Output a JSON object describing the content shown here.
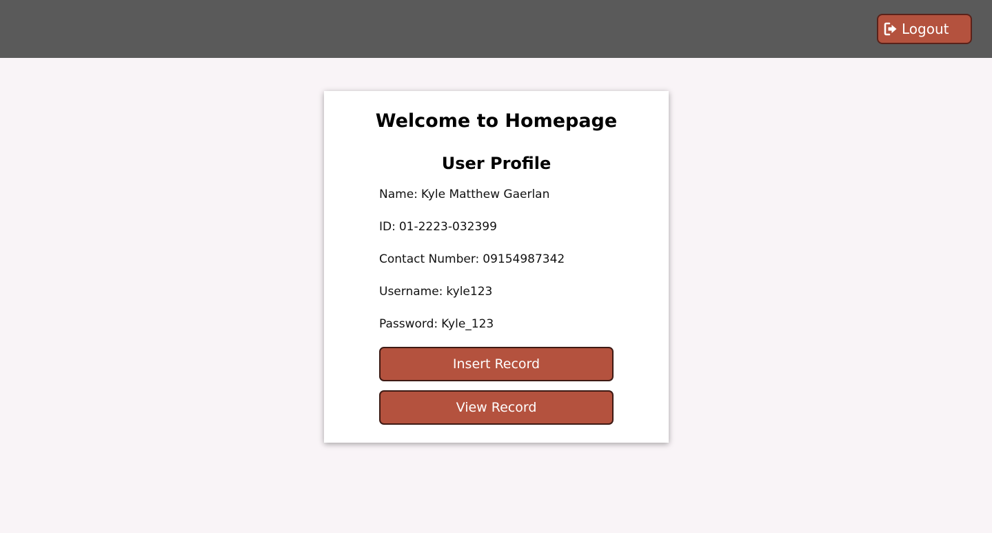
{
  "header": {
    "logout_label": "Logout",
    "logout_icon": "sign-out-icon"
  },
  "card": {
    "welcome_title": "Welcome to Homepage",
    "profile_heading": "User Profile",
    "fields": [
      {
        "label": "Name:",
        "value": "Kyle Matthew Gaerlan"
      },
      {
        "label": "ID:",
        "value": "01-2223-032399"
      },
      {
        "label": "Contact Number:",
        "value": "09154987342"
      },
      {
        "label": "Username:",
        "value": "kyle123"
      },
      {
        "label": "Password:",
        "value": "Kyle_123"
      }
    ],
    "insert_label": "Insert Record",
    "view_label": "View Record"
  },
  "colors": {
    "header_bg": "#5a5a5a",
    "page_bg": "#f9f4f7",
    "accent": "#b4523e"
  }
}
